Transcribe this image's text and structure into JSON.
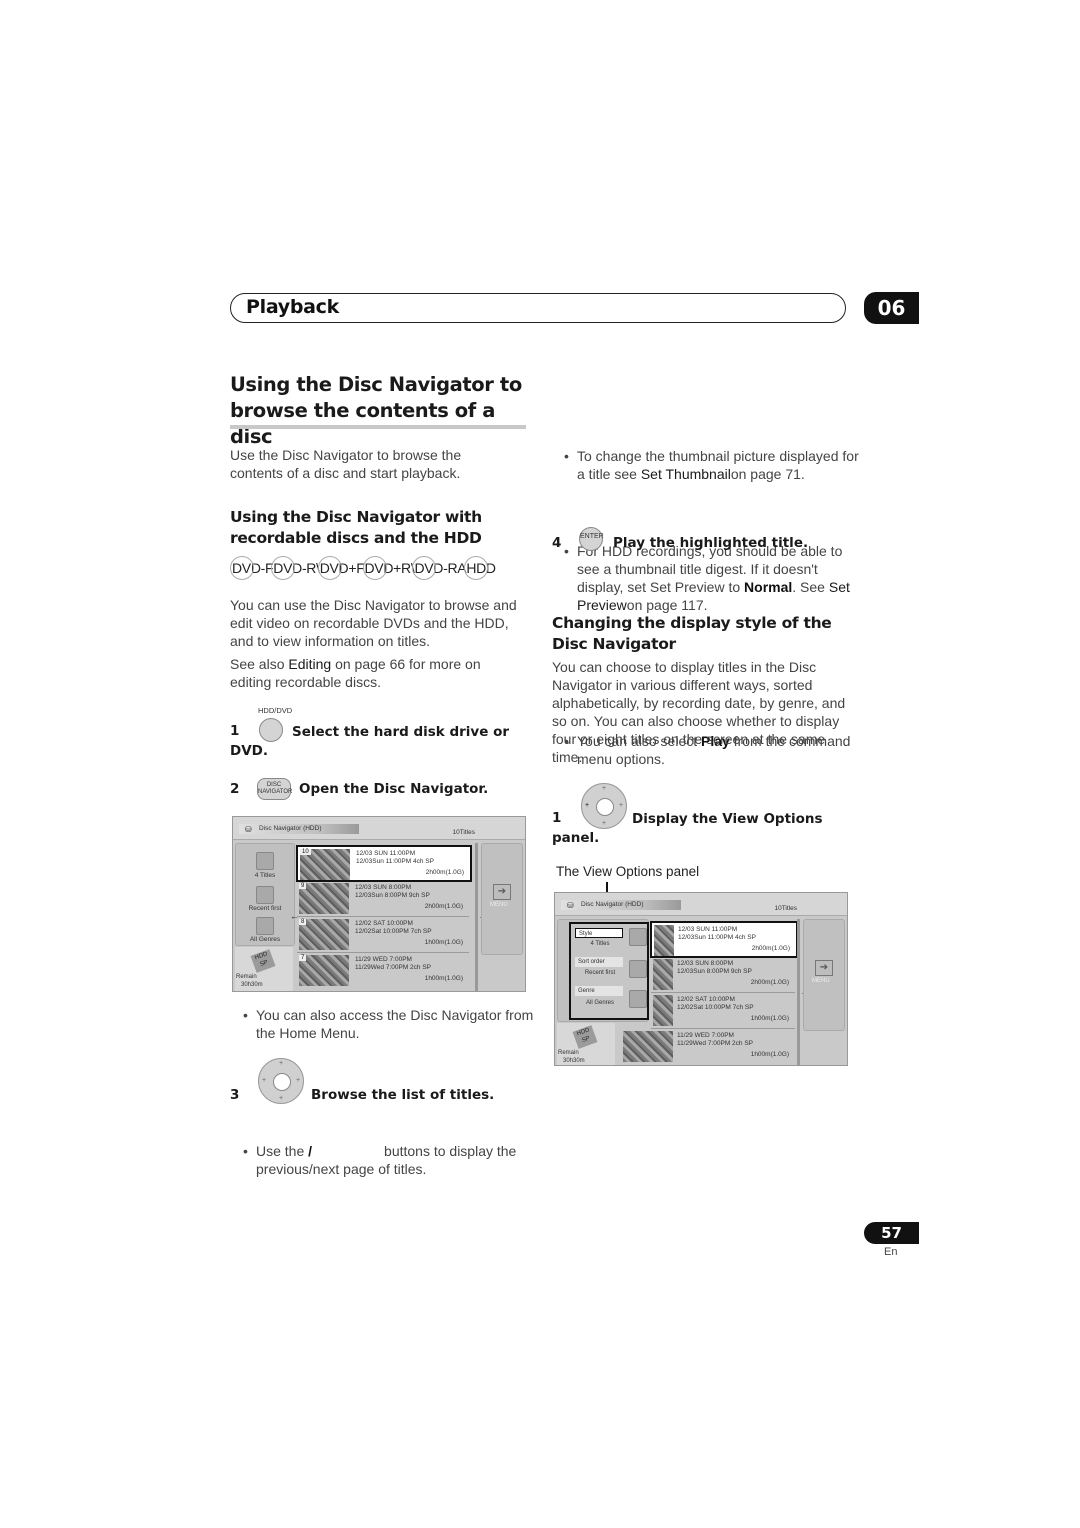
{
  "header": {
    "section": "Playback",
    "chapter": "06"
  },
  "left": {
    "title": "Using the Disc Navigator to browse the contents of a disc",
    "intro": "Use the Disc Navigator to browse the contents of a disc and start playback.",
    "subtitle": "Using the Disc Navigator with recordable discs and the HDD",
    "discs": [
      "DVD-R",
      "DVD-RW",
      "DVD+R",
      "DVD+RW",
      "DVD-RAM",
      "HDD"
    ],
    "disc_text": [
      "DVD-F",
      "DVD-R\\",
      "DVD+F",
      "DVD+R\\",
      "DVD-RA",
      "HDD"
    ],
    "p1": "You can use the Disc Navigator to browse and edit video on recordable DVDs and the HDD, and to view information on  titles.",
    "p2_pre": "See also ",
    "p2_ref": "Editing",
    "p2_post": " on page 66 for more on editing recordable discs.",
    "step1": {
      "num": "1",
      "button": "HDD/DVD",
      "text": "Select the hard disk drive or DVD."
    },
    "step2": {
      "num": "2",
      "button": "DISC NAVIGATOR",
      "text": "Open the Disc Navigator."
    },
    "bullet_home": "You can also access the Disc Navigator from the Home Menu.",
    "step3": {
      "num": "3",
      "text": "Browse the list of titles."
    },
    "bullet_page_pre": "Use the ",
    "bullet_page_sym": "/",
    "bullet_page_post": "buttons to display the previous/next page of titles."
  },
  "screen": {
    "title": "Disc Navigator (HDD)",
    "count": "10Titles",
    "left_items": [
      "4 Titles",
      "Recent first",
      "All Genres"
    ],
    "hdd": "HDD",
    "mode": "SP",
    "remain_label": "Remain",
    "remain": "30h30m",
    "menu": "MENU",
    "rows": [
      {
        "n": "10",
        "l1": "12/03 SUN  11:00PM",
        "l2": "12/03Sun   11:00PM  4ch  SP",
        "l3": "2h00m(1.0G)"
      },
      {
        "n": "9",
        "l1": "12/03 SUN  8:00PM",
        "l2": "12/03Sun   8:00PM  9ch  SP",
        "l3": "2h00m(1.0G)"
      },
      {
        "n": "8",
        "l1": "12/02  SAT  10:00PM",
        "l2": "12/02Sat  10:00PM  7ch  SP",
        "l3": "1h00m(1.0G)"
      },
      {
        "n": "7",
        "l1": "11/29  WED  7:00PM",
        "l2": "11/29Wed  7:00PM  2ch  SP",
        "l3": "1h00m(1.0G)"
      }
    ]
  },
  "right": {
    "bullet_thumb_pre": "To change the thumbnail picture displayed for a title see ",
    "bullet_thumb_ref": "Set Thumbnail",
    "bullet_thumb_post": "on page 71.",
    "bullet_hdd_pre": "For HDD recordings, you should be able to see a thumbnail title digest. If it doesn't display, set Set Preview to ",
    "bullet_hdd_bold": "Normal",
    "bullet_hdd_mid": ". See ",
    "bullet_hdd_ref": "Set Preview",
    "bullet_hdd_post": "on page 117.",
    "step4": {
      "num": "4",
      "button": "ENTER",
      "text": "Play the highlighted title."
    },
    "bullet_play_pre": "You can also select ",
    "bullet_play_bold": "Play",
    "bullet_play_post": " from the command menu options.",
    "subtitle": "Changing the display style of the Disc Navigator",
    "p": "You can choose to display titles in the Disc Navigator in various different ways, sorted alphabetically, by recording date, by genre, and so on. You can also choose whether to display four or eight titles on the screen at the same time.",
    "step1": {
      "num": "1",
      "text": "Display the View Options panel."
    },
    "caption": "The View Options panel",
    "view_options": [
      {
        "field": "Style",
        "value": "4 Titles"
      },
      {
        "field": "Sort order",
        "value": "Recent first"
      },
      {
        "field": "Genre",
        "value": "All Genres"
      }
    ]
  },
  "footer": {
    "page": "57",
    "lang": "En"
  }
}
